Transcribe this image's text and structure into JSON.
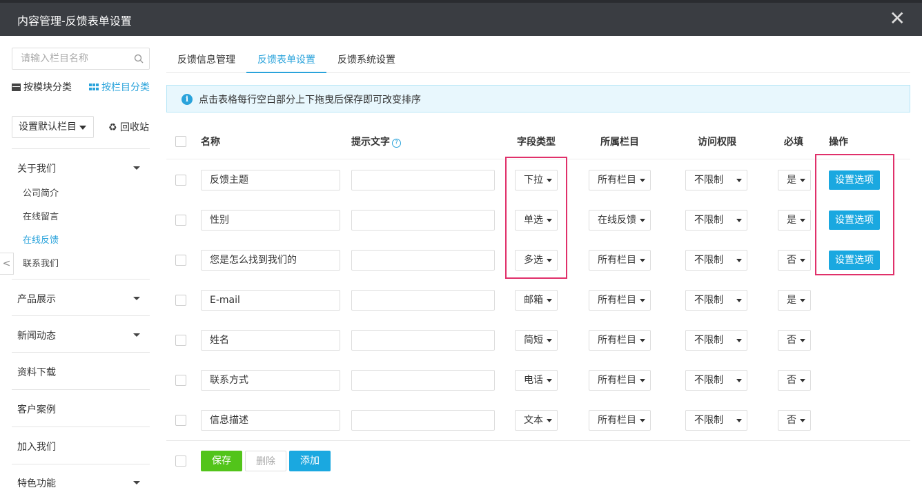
{
  "window": {
    "title": "内容管理-反馈表单设置",
    "close_label": "✕"
  },
  "sidebar": {
    "search_placeholder": "请输入栏目名称",
    "by_module": "按模块分类",
    "by_column": "按栏目分类",
    "default_column": "设置默认栏目",
    "recycle": "♻ 回收站",
    "groups": [
      {
        "label": "关于我们",
        "children": [
          "公司简介",
          "在线留言",
          "在线反馈",
          "联系我们"
        ],
        "active_child": "在线反馈"
      },
      {
        "label": "产品展示"
      },
      {
        "label": "新闻动态"
      },
      {
        "label": "资料下载"
      },
      {
        "label": "客户案例"
      },
      {
        "label": "加入我们"
      },
      {
        "label": "特色功能"
      }
    ],
    "collapse": "<"
  },
  "tabs": [
    "反馈信息管理",
    "反馈表单设置",
    "反馈系统设置"
  ],
  "active_tab": "反馈表单设置",
  "notice": {
    "icon": "i",
    "text": "点击表格每行空白部分上下拖曳后保存即可改变排序"
  },
  "table": {
    "headers": {
      "name": "名称",
      "hint": "提示文字",
      "help_icon": "?",
      "type": "字段类型",
      "column": "所属栏目",
      "access": "访问权限",
      "required": "必填",
      "action": "操作"
    },
    "rows": [
      {
        "name": "反馈主题",
        "hint": "",
        "type": "下拉",
        "column": "所有栏目",
        "access": "不限制",
        "required": "是",
        "action": "设置选项"
      },
      {
        "name": "性别",
        "hint": "",
        "type": "单选",
        "column": "在线反馈",
        "access": "不限制",
        "required": "是",
        "action": "设置选项"
      },
      {
        "name": "您是怎么找到我们的",
        "hint": "",
        "type": "多选",
        "column": "所有栏目",
        "access": "不限制",
        "required": "否",
        "action": "设置选项"
      },
      {
        "name": "E-mail",
        "hint": "",
        "type": "邮箱",
        "column": "所有栏目",
        "access": "不限制",
        "required": "是",
        "action": ""
      },
      {
        "name": "姓名",
        "hint": "",
        "type": "简短",
        "column": "所有栏目",
        "access": "不限制",
        "required": "否",
        "action": ""
      },
      {
        "name": "联系方式",
        "hint": "",
        "type": "电话",
        "column": "所有栏目",
        "access": "不限制",
        "required": "否",
        "action": ""
      },
      {
        "name": "信息描述",
        "hint": "",
        "type": "文本",
        "column": "所有栏目",
        "access": "不限制",
        "required": "否",
        "action": ""
      }
    ]
  },
  "footer": {
    "save": "保存",
    "delete": "删除",
    "add": "添加"
  },
  "colors": {
    "accent": "#2aa3db",
    "save": "#52c41a",
    "highlight": "#e0306a",
    "titlebar": "#3a3d42"
  }
}
